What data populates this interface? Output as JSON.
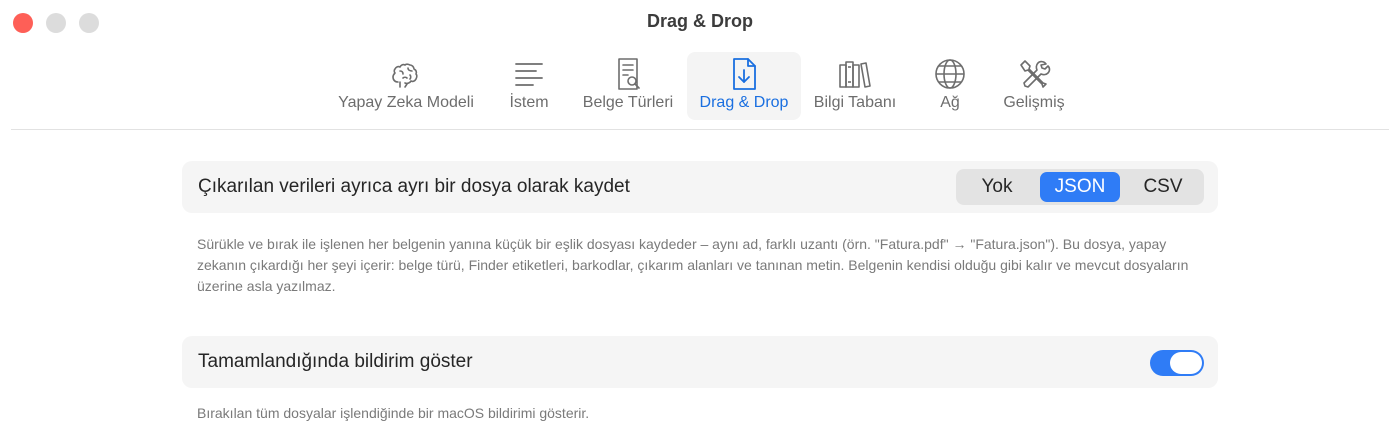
{
  "window": {
    "title": "Drag & Drop"
  },
  "toolbar": {
    "tabs": [
      {
        "label": "Yapay Zeka Modeli",
        "icon": "brain-icon",
        "active": false
      },
      {
        "label": "İstem",
        "icon": "text-lines-icon",
        "active": false
      },
      {
        "label": "Belge Türleri",
        "icon": "document-search-icon",
        "active": false
      },
      {
        "label": "Drag & Drop",
        "icon": "document-download-icon",
        "active": true
      },
      {
        "label": "Bilgi Tabanı",
        "icon": "books-icon",
        "active": false
      },
      {
        "label": "Ağ",
        "icon": "globe-icon",
        "active": false
      },
      {
        "label": "Gelişmiş",
        "icon": "tools-icon",
        "active": false
      }
    ]
  },
  "settings": {
    "save_extracted": {
      "label": "Çıkarılan verileri ayrıca ayrı bir dosya olarak kaydet",
      "options": [
        "Yok",
        "JSON",
        "CSV"
      ],
      "selected": "JSON",
      "description": "Sürükle ve bırak ile işlenen her belgenin yanına küçük bir eşlik dosyası kaydeder – aynı ad, farklı uzantı (örn. \"Fatura.pdf\" → \"Fatura.json\"). Bu dosya, yapay zekanın çıkardığı her şeyi içerir: belge türü, Finder etiketleri, barkodlar, çıkarım alanları ve tanınan metin. Belgenin kendisi olduğu gibi kalır ve mevcut dosyaların üzerine asla yazılmaz."
    },
    "notify": {
      "label": "Tamamlandığında bildirim göster",
      "enabled": true,
      "description": "Bırakılan tüm dosyalar işlendiğinde bir macOS bildirimi gösterir."
    }
  },
  "colors": {
    "accent": "#2f7cf6",
    "active_tab_text": "#1a6fe0",
    "close_button": "#fe5f57"
  }
}
